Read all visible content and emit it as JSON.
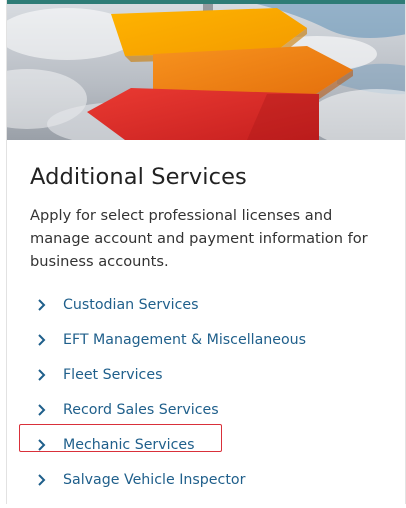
{
  "card": {
    "title": "Additional Services",
    "description": "Apply for select professional licenses and manage account and payment information for business accounts."
  },
  "links": [
    {
      "label": "Custodian Services"
    },
    {
      "label": "EFT Management & Miscellaneous"
    },
    {
      "label": "Fleet Services"
    },
    {
      "label": "Record Sales Services"
    },
    {
      "label": "Mechanic Services"
    },
    {
      "label": "Salvage Vehicle Inspector"
    }
  ],
  "icons": {
    "link_chevron": "chevron-right-icon",
    "hero": "signpost-arrows-image"
  },
  "colors": {
    "accent_bar": "#2e7c76",
    "link": "#1f5f8b",
    "highlight": "#d9303a",
    "title": "#222222"
  },
  "highlighted_link": "Mechanic Services"
}
